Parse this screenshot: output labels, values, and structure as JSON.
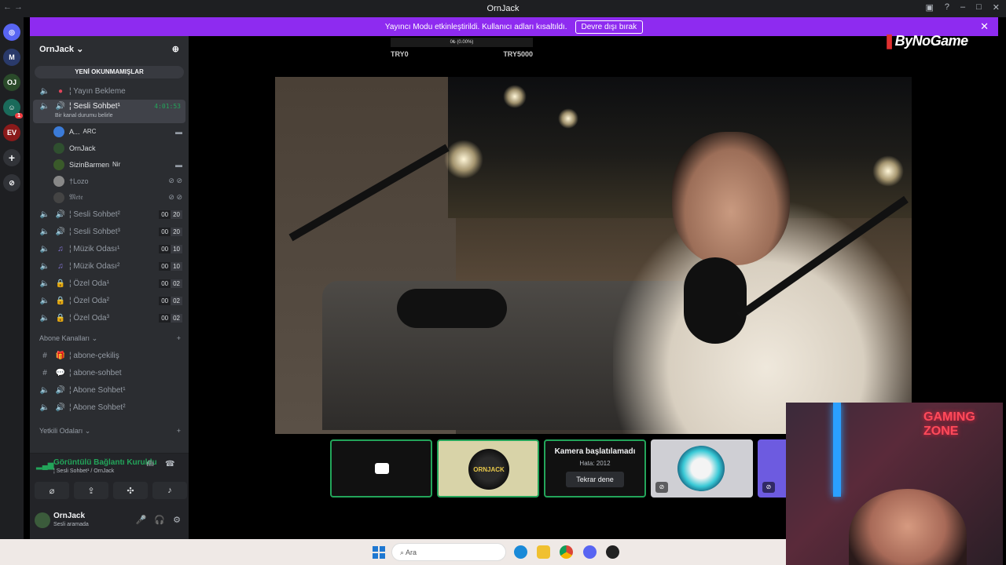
{
  "window": {
    "title": "OrnJack",
    "nav": "← →"
  },
  "banner": {
    "text": "Yayıncı Modu etkinleştirildi. Kullanıcı adları kısaltıldı.",
    "button": "Devre dışı bırak"
  },
  "server": {
    "name": "OrnJack",
    "new_unread": "YENİ OKUNMAMIŞLAR",
    "channels_top": [
      {
        "name": "¦ Yayın Bekleme"
      }
    ],
    "active_channel": {
      "name": "¦ Sesli Sohbet¹",
      "timer": "4:01:53",
      "status": "Bir kanal durumu belirle"
    },
    "voice_users": [
      {
        "name": "A...",
        "tag": "ARC"
      },
      {
        "name": "OrnJack",
        "tag": ""
      },
      {
        "name": "SizinBarmen",
        "tag": "Nir"
      },
      {
        "name": "†Lozo",
        "tag": ""
      },
      {
        "name": "𝔐𝔢𝔱𝔢",
        "tag": ""
      }
    ],
    "voice_channels": [
      {
        "name": "¦ Sesli Sohbet²",
        "count": [
          "00",
          "20"
        ]
      },
      {
        "name": "¦ Sesli Sohbet³",
        "count": [
          "00",
          "20"
        ]
      },
      {
        "name": "¦ Müzik Odası¹",
        "count": [
          "00",
          "10"
        ]
      },
      {
        "name": "¦ Müzik Odası²",
        "count": [
          "00",
          "10"
        ]
      },
      {
        "name": "¦ Özel Oda¹",
        "count": [
          "00",
          "02"
        ]
      },
      {
        "name": "¦ Özel Oda²",
        "count": [
          "00",
          "02"
        ]
      },
      {
        "name": "¦ Özel Oda³",
        "count": [
          "00",
          "02"
        ]
      }
    ],
    "category": "Abone Kanalları",
    "sub_channels": [
      {
        "name": "¦ abone-çekiliş",
        "icon": "#"
      },
      {
        "name": "¦ abone-sohbet",
        "icon": "#"
      },
      {
        "name": "¦ Abone Sohbet¹",
        "icon": "speaker"
      },
      {
        "name": "¦ Abone Sohbet²",
        "icon": "speaker"
      }
    ],
    "category2": "Yetkili Odaları"
  },
  "voice_panel": {
    "status": "Görüntülü Bağlantı Kuruldu",
    "sub": "¦ Sesli Sohbet¹ / OrnJack"
  },
  "user_panel": {
    "name": "OrnJack",
    "status": "Sesli aramada"
  },
  "overlay": {
    "progress_text": "0₺ (0.00%)",
    "progress_fraction": 0.0,
    "min": "TRY0",
    "max": "TRY5000",
    "brand": "ByNoGame"
  },
  "tiles": {
    "camera_title": "Kamera başlatılamadı",
    "camera_error": "Hata: 2012",
    "retry": "Tekrar dene",
    "ornjack_label": "ORNJACK"
  },
  "facecam": {
    "neon": "GAMING ZONE"
  },
  "taskbar": {
    "search_placeholder": "Ara"
  },
  "colors": {
    "accent": "#8e2bf0",
    "online": "#23a55a",
    "sidebar": "#2b2d31"
  }
}
